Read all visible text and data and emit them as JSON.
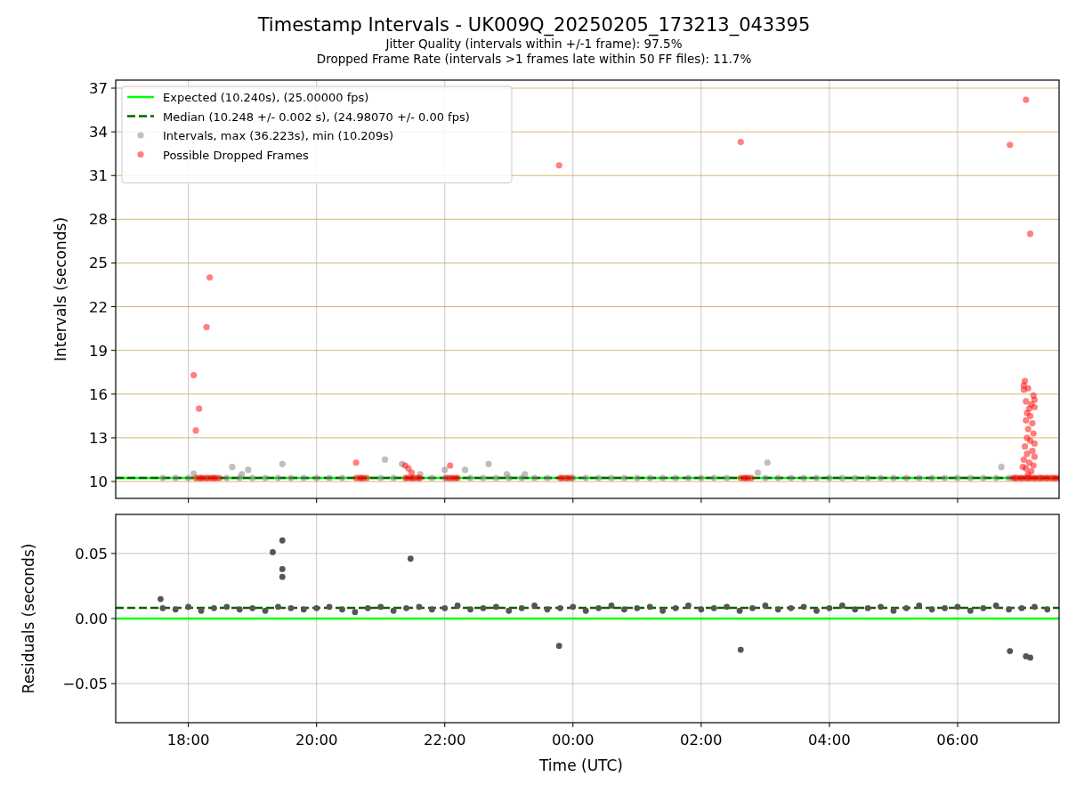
{
  "figure": {
    "title": "Timestamp Intervals - UK009Q_20250205_173213_043395",
    "subtitles": [
      "Jitter Quality (intervals within +/-1 frame): 97.5%",
      "Dropped Frame Rate (intervals >1 frames late within 50 FF files): 11.7%"
    ]
  },
  "panels": [
    {
      "chart_data": {
        "type": "scatter",
        "ylabel": "Intervals (seconds)",
        "grid": true,
        "xlim": [
          "2025-02-05T16:52",
          "2025-02-06T07:35"
        ],
        "ylim": [
          8.84,
          37.55
        ],
        "yticks": [
          {
            "value": 10,
            "label": "10"
          },
          {
            "value": 13,
            "label": "13"
          },
          {
            "value": 16,
            "label": "16"
          },
          {
            "value": 19,
            "label": "19"
          },
          {
            "value": 22,
            "label": "22"
          },
          {
            "value": 25,
            "label": "25"
          },
          {
            "value": 28,
            "label": "28"
          },
          {
            "value": 31,
            "label": "31"
          },
          {
            "value": 34,
            "label": "34"
          },
          {
            "value": 37,
            "label": "37"
          }
        ],
        "legend": "upper left",
        "ref_lines": [
          {
            "axis": "y",
            "label": "Expected (10.240s), (25.00000 fps)",
            "value": 10.24,
            "color": "#00ff00"
          },
          {
            "axis": "y",
            "label": "Median (10.248 +/- 0.002 s), (24.98070 +/- 0.00 fps)",
            "value": 10.248,
            "color": "#006400"
          }
        ],
        "series": [
          {
            "name": "Intervals, max (36.223s), min (10.209s)",
            "color": "#808080",
            "x": [
              "2025-02-05T17:36",
              "2025-02-05T17:48",
              "2025-02-05T18:00",
              "2025-02-05T18:36",
              "2025-02-05T18:48",
              "2025-02-05T19:00",
              "2025-02-05T19:12",
              "2025-02-05T19:24",
              "2025-02-05T19:36",
              "2025-02-05T19:48",
              "2025-02-05T20:00",
              "2025-02-05T20:12",
              "2025-02-05T20:24",
              "2025-02-05T21:00",
              "2025-02-05T21:12",
              "2025-02-05T21:48",
              "2025-02-05T22:00",
              "2025-02-05T22:24",
              "2025-02-05T22:36",
              "2025-02-05T22:48",
              "2025-02-05T23:00",
              "2025-02-05T23:12",
              "2025-02-05T23:24",
              "2025-02-05T23:36",
              "2025-02-06T00:00",
              "2025-02-06T00:12",
              "2025-02-06T00:24",
              "2025-02-06T00:36",
              "2025-02-06T00:48",
              "2025-02-06T01:00",
              "2025-02-06T01:12",
              "2025-02-06T01:24",
              "2025-02-06T01:36",
              "2025-02-06T01:48",
              "2025-02-06T02:00",
              "2025-02-06T02:12",
              "2025-02-06T02:24",
              "2025-02-06T03:00",
              "2025-02-06T03:12",
              "2025-02-06T03:24",
              "2025-02-06T03:36",
              "2025-02-06T03:48",
              "2025-02-06T04:00",
              "2025-02-06T04:12",
              "2025-02-06T04:24",
              "2025-02-06T04:36",
              "2025-02-06T04:48",
              "2025-02-06T05:00",
              "2025-02-06T05:12",
              "2025-02-06T05:24",
              "2025-02-06T05:36",
              "2025-02-06T05:48",
              "2025-02-06T06:00",
              "2025-02-06T06:12",
              "2025-02-06T06:24",
              "2025-02-06T06:36",
              "2025-02-06T06:48",
              "2025-02-05T18:05",
              "2025-02-05T18:41",
              "2025-02-05T18:50",
              "2025-02-05T18:56",
              "2025-02-05T19:28",
              "2025-02-05T21:04",
              "2025-02-05T21:20",
              "2025-02-05T21:37",
              "2025-02-05T22:00",
              "2025-02-05T22:19",
              "2025-02-05T22:41",
              "2025-02-05T22:58",
              "2025-02-05T23:15",
              "2025-02-06T02:53",
              "2025-02-06T03:02",
              "2025-02-06T06:41"
            ],
            "values": [
              10.24,
              10.24,
              10.24,
              10.24,
              10.24,
              10.24,
              10.24,
              10.24,
              10.24,
              10.24,
              10.24,
              10.24,
              10.24,
              10.24,
              10.24,
              10.24,
              10.24,
              10.24,
              10.24,
              10.24,
              10.24,
              10.24,
              10.24,
              10.24,
              10.24,
              10.24,
              10.24,
              10.24,
              10.24,
              10.24,
              10.24,
              10.24,
              10.24,
              10.24,
              10.24,
              10.24,
              10.24,
              10.24,
              10.24,
              10.24,
              10.24,
              10.24,
              10.24,
              10.24,
              10.24,
              10.24,
              10.24,
              10.24,
              10.24,
              10.24,
              10.24,
              10.24,
              10.24,
              10.24,
              10.24,
              10.24,
              10.24,
              10.55,
              11.0,
              10.5,
              10.8,
              11.2,
              11.5,
              11.2,
              10.5,
              10.8,
              10.8,
              11.2,
              10.5,
              10.5,
              10.6,
              11.3,
              11.0
            ]
          },
          {
            "name": "Possible Dropped Frames",
            "color": "#ff0000",
            "x": [
              "2025-02-05T18:07",
              "2025-02-05T18:10",
              "2025-02-05T18:12",
              "2025-02-05T18:14",
              "2025-02-05T18:17",
              "2025-02-05T18:19",
              "2025-02-05T18:22",
              "2025-02-05T18:24",
              "2025-02-05T18:26",
              "2025-02-05T18:29",
              "2025-02-05T20:37",
              "2025-02-05T20:40",
              "2025-02-05T20:42",
              "2025-02-05T20:44",
              "2025-02-05T20:47",
              "2025-02-05T21:23",
              "2025-02-05T21:25",
              "2025-02-05T21:28",
              "2025-02-05T21:30",
              "2025-02-05T21:32",
              "2025-02-05T21:35",
              "2025-02-05T21:37",
              "2025-02-05T22:02",
              "2025-02-05T22:05",
              "2025-02-05T22:07",
              "2025-02-05T22:10",
              "2025-02-05T22:12",
              "2025-02-05T23:48",
              "2025-02-05T23:50",
              "2025-02-05T23:53",
              "2025-02-05T23:55",
              "2025-02-05T23:58",
              "2025-02-06T02:37",
              "2025-02-06T02:40",
              "2025-02-06T02:42",
              "2025-02-06T02:44",
              "2025-02-06T02:47",
              "2025-02-06T06:52",
              "2025-02-06T06:54",
              "2025-02-06T06:56",
              "2025-02-06T06:59",
              "2025-02-06T07:01",
              "2025-02-06T07:04",
              "2025-02-06T07:06",
              "2025-02-06T07:08",
              "2025-02-06T07:11",
              "2025-02-06T07:13",
              "2025-02-06T07:16",
              "2025-02-06T07:18",
              "2025-02-06T07:20",
              "2025-02-06T07:23",
              "2025-02-06T07:25",
              "2025-02-06T07:28",
              "2025-02-06T07:30",
              "2025-02-06T07:32",
              "2025-02-06T07:35",
              "2025-02-05T18:05",
              "2025-02-05T18:10",
              "2025-02-05T18:07",
              "2025-02-05T18:17",
              "2025-02-05T18:20",
              "2025-02-05T20:37",
              "2025-02-05T21:23",
              "2025-02-05T21:26",
              "2025-02-05T21:29",
              "2025-02-05T22:05",
              "2025-02-05T23:47",
              "2025-02-06T02:37",
              "2025-02-06T06:49",
              "2025-02-06T07:04",
              "2025-02-06T07:08",
              "2025-02-06T07:03",
              "2025-02-06T07:02",
              "2025-02-06T07:02",
              "2025-02-06T07:06",
              "2025-02-06T07:11",
              "2025-02-06T07:12",
              "2025-02-06T07:09",
              "2025-02-06T07:04",
              "2025-02-06T07:07",
              "2025-02-06T07:12",
              "2025-02-06T07:05",
              "2025-02-06T07:08",
              "2025-02-06T07:04",
              "2025-02-06T07:10",
              "2025-02-06T07:06",
              "2025-02-06T07:11",
              "2025-02-06T07:05",
              "2025-02-06T07:08",
              "2025-02-06T07:12",
              "2025-02-06T07:03",
              "2025-02-06T07:10",
              "2025-02-06T07:05",
              "2025-02-06T07:12",
              "2025-02-06T07:02",
              "2025-02-06T07:07",
              "2025-02-06T07:11",
              "2025-02-06T07:04",
              "2025-02-06T07:09",
              "2025-02-06T07:06",
              "2025-02-06T07:01"
            ],
            "values": [
              10.24,
              10.24,
              10.24,
              10.24,
              10.24,
              10.24,
              10.24,
              10.24,
              10.24,
              10.24,
              10.24,
              10.24,
              10.24,
              10.24,
              10.24,
              10.24,
              10.24,
              10.24,
              10.24,
              10.24,
              10.24,
              10.24,
              10.24,
              10.24,
              10.24,
              10.24,
              10.24,
              10.24,
              10.24,
              10.24,
              10.24,
              10.24,
              10.24,
              10.24,
              10.24,
              10.24,
              10.24,
              10.24,
              10.24,
              10.24,
              10.24,
              10.24,
              10.24,
              10.24,
              10.24,
              10.24,
              10.24,
              10.24,
              10.24,
              10.24,
              10.24,
              10.24,
              10.24,
              10.24,
              10.24,
              10.24,
              17.3,
              15.0,
              13.5,
              20.6,
              24.0,
              11.3,
              11.1,
              10.9,
              10.6,
              11.1,
              31.7,
              33.3,
              33.1,
              36.2,
              27.0,
              16.9,
              16.6,
              16.3,
              16.4,
              15.9,
              15.6,
              15.3,
              15.5,
              15.0,
              15.1,
              14.7,
              14.5,
              14.2,
              14.0,
              13.6,
              13.3,
              13.0,
              12.8,
              12.6,
              12.4,
              12.1,
              11.9,
              11.7,
              11.5,
              11.3,
              11.1,
              10.9,
              10.7,
              10.5,
              11.0
            ]
          }
        ]
      }
    },
    {
      "chart_data": {
        "type": "scatter",
        "xlabel": "Time (UTC)",
        "ylabel": "Residuals (seconds)",
        "grid": true,
        "xlim": [
          "2025-02-05T16:52",
          "2025-02-06T07:35"
        ],
        "ylim": [
          -0.08,
          0.08
        ],
        "xticks": [
          {
            "value": "2025-02-05T18:00",
            "label": "18:00"
          },
          {
            "value": "2025-02-05T20:00",
            "label": "20:00"
          },
          {
            "value": "2025-02-05T22:00",
            "label": "22:00"
          },
          {
            "value": "2025-02-06T00:00",
            "label": "00:00"
          },
          {
            "value": "2025-02-06T02:00",
            "label": "02:00"
          },
          {
            "value": "2025-02-06T04:00",
            "label": "04:00"
          },
          {
            "value": "2025-02-06T06:00",
            "label": "06:00"
          }
        ],
        "yticks": [
          {
            "value": -0.05,
            "label": "−0.05"
          },
          {
            "value": 0,
            "label": "0.00"
          },
          {
            "value": 0.05,
            "label": "0.05"
          }
        ],
        "ref_lines": [
          {
            "axis": "y",
            "value": 0,
            "color": "#00ff00"
          },
          {
            "axis": "y",
            "value": 0.0082,
            "color": "#006400"
          }
        ],
        "series": [
          {
            "color": "#555555",
            "x": [
              "2025-02-05T17:36",
              "2025-02-05T17:48",
              "2025-02-05T18:00",
              "2025-02-05T18:12",
              "2025-02-05T18:24",
              "2025-02-05T18:36",
              "2025-02-05T18:48",
              "2025-02-05T19:00",
              "2025-02-05T19:12",
              "2025-02-05T19:24",
              "2025-02-05T19:36",
              "2025-02-05T19:48",
              "2025-02-05T20:00",
              "2025-02-05T20:12",
              "2025-02-05T20:24",
              "2025-02-05T20:36",
              "2025-02-05T20:48",
              "2025-02-05T21:00",
              "2025-02-05T21:12",
              "2025-02-05T21:24",
              "2025-02-05T21:36",
              "2025-02-05T21:48",
              "2025-02-05T22:00",
              "2025-02-05T22:12",
              "2025-02-05T22:24",
              "2025-02-05T22:36",
              "2025-02-05T22:48",
              "2025-02-05T23:00",
              "2025-02-05T23:12",
              "2025-02-05T23:24",
              "2025-02-05T23:36",
              "2025-02-05T23:48",
              "2025-02-06T00:00",
              "2025-02-06T00:12",
              "2025-02-06T00:24",
              "2025-02-06T00:36",
              "2025-02-06T00:48",
              "2025-02-06T01:00",
              "2025-02-06T01:12",
              "2025-02-06T01:24",
              "2025-02-06T01:36",
              "2025-02-06T01:48",
              "2025-02-06T02:00",
              "2025-02-06T02:12",
              "2025-02-06T02:24",
              "2025-02-06T02:36",
              "2025-02-06T02:48",
              "2025-02-06T03:00",
              "2025-02-06T03:12",
              "2025-02-06T03:24",
              "2025-02-06T03:36",
              "2025-02-06T03:48",
              "2025-02-06T04:00",
              "2025-02-06T04:12",
              "2025-02-06T04:24",
              "2025-02-06T04:36",
              "2025-02-06T04:48",
              "2025-02-06T05:00",
              "2025-02-06T05:12",
              "2025-02-06T05:24",
              "2025-02-06T05:36",
              "2025-02-06T05:48",
              "2025-02-06T06:00",
              "2025-02-06T06:12",
              "2025-02-06T06:24",
              "2025-02-06T06:36",
              "2025-02-06T06:48",
              "2025-02-06T07:00",
              "2025-02-06T07:12",
              "2025-02-06T07:24",
              "2025-02-05T17:34",
              "2025-02-05T19:19",
              "2025-02-05T19:28",
              "2025-02-05T19:28",
              "2025-02-05T19:28",
              "2025-02-05T21:28",
              "2025-02-05T23:47",
              "2025-02-06T02:37",
              "2025-02-06T06:49",
              "2025-02-06T07:04",
              "2025-02-06T07:08"
            ],
            "values": [
              0.008,
              0.007,
              0.009,
              0.006,
              0.008,
              0.009,
              0.007,
              0.008,
              0.006,
              0.009,
              0.008,
              0.007,
              0.008,
              0.009,
              0.007,
              0.005,
              0.008,
              0.009,
              0.006,
              0.008,
              0.009,
              0.007,
              0.008,
              0.01,
              0.007,
              0.008,
              0.009,
              0.006,
              0.008,
              0.01,
              0.007,
              0.008,
              0.009,
              0.006,
              0.008,
              0.01,
              0.007,
              0.008,
              0.009,
              0.006,
              0.008,
              0.01,
              0.007,
              0.008,
              0.009,
              0.006,
              0.008,
              0.01,
              0.007,
              0.008,
              0.009,
              0.006,
              0.008,
              0.01,
              0.007,
              0.008,
              0.009,
              0.006,
              0.008,
              0.01,
              0.007,
              0.008,
              0.009,
              0.006,
              0.008,
              0.01,
              0.007,
              0.008,
              0.009,
              0.007,
              0.015,
              0.051,
              0.06,
              0.038,
              0.032,
              0.046,
              -0.021,
              -0.024,
              -0.025,
              -0.029,
              -0.03
            ]
          }
        ]
      }
    }
  ]
}
